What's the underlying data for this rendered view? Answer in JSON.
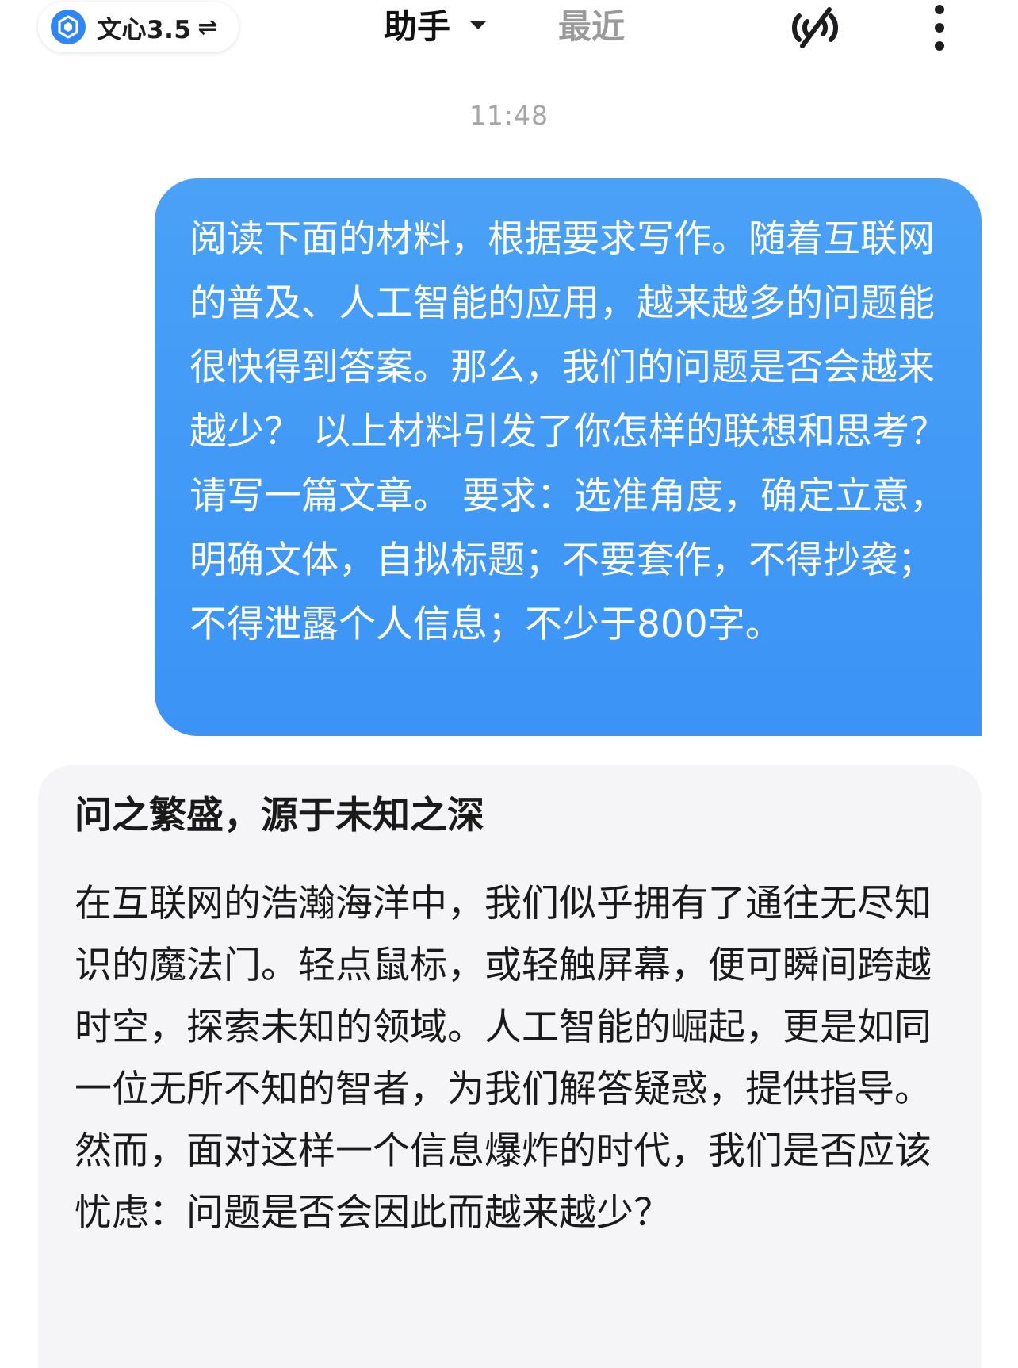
{
  "header": {
    "model_label": "文心3.5",
    "swap_icon": "⇌",
    "tabs": [
      {
        "label": "助手",
        "active": true
      },
      {
        "label": "最近",
        "active": false
      }
    ],
    "icons": {
      "model_logo": "model-logo-icon",
      "voice": "voice-muted-icon",
      "more": "more-vertical-icon"
    },
    "accent_color": "#3b93f6"
  },
  "chat": {
    "timestamp": "11:48",
    "user_message": "阅读下面的材料，根据要求写作。随着互联网的普及、人工智能的应用，越来越多的问题能很快得到答案。那么，我们的问题是否会越来越少？ 以上材料引发了你怎样的联想和思考？请写一篇文章。 要求：选准角度，确定立意，明确文体，自拟标题；不要套作，不得抄袭；不得泄露个人信息；不少于800字。",
    "answer": {
      "title": "问之繁盛，源于未知之深",
      "paragraph": "在互联网的浩瀚海洋中，我们似乎拥有了通往无尽知识的魔法门。轻点鼠标，或轻触屏幕，便可瞬间跨越时空，探索未知的领域。人工智能的崛起，更是如同一位无所不知的智者，为我们解答疑惑，提供指导。然而，面对这样一个信息爆炸的时代，我们是否应该忧虑：问题是否会因此而越来越少？"
    }
  }
}
